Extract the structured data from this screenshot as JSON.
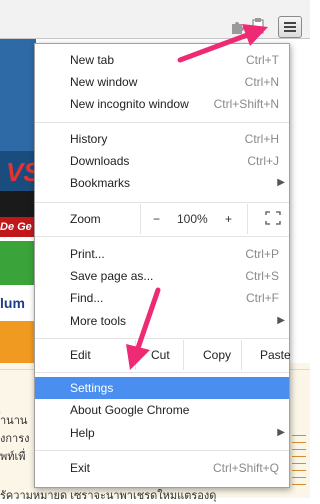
{
  "menu": {
    "items": [
      {
        "label": "New tab",
        "shortcut": "Ctrl+T"
      },
      {
        "label": "New window",
        "shortcut": "Ctrl+N"
      },
      {
        "label": "New incognito window",
        "shortcut": "Ctrl+Shift+N"
      },
      {
        "label": "History",
        "shortcut": "Ctrl+H"
      },
      {
        "label": "Downloads",
        "shortcut": "Ctrl+J"
      },
      {
        "label": "Bookmarks",
        "shortcut": ""
      },
      {
        "label": "Print...",
        "shortcut": "Ctrl+P"
      },
      {
        "label": "Save page as...",
        "shortcut": "Ctrl+S"
      },
      {
        "label": "Find...",
        "shortcut": "Ctrl+F"
      },
      {
        "label": "More tools",
        "shortcut": ""
      },
      {
        "label": "Settings",
        "shortcut": ""
      },
      {
        "label": "About Google Chrome",
        "shortcut": ""
      },
      {
        "label": "Help",
        "shortcut": ""
      },
      {
        "label": "Exit",
        "shortcut": "Ctrl+Shift+Q"
      }
    ],
    "zoom": {
      "label": "Zoom",
      "minus": "−",
      "value": "100%",
      "plus": "+"
    },
    "edit": {
      "label": "Edit",
      "cut": "Cut",
      "copy": "Copy",
      "paste": "Paste"
    },
    "selected": "Settings"
  },
  "background_page": {
    "fragments": [
      "VS",
      "De Ge",
      "lum",
      "้านาน",
      "งการง",
      "พท์เพื่",
      "รัความหมายด เซราจะนาพาเชรดใหมแตรองดุ"
    ]
  },
  "colors": {
    "highlight": "#4a8ef0",
    "arrow": "#ee2a74"
  }
}
